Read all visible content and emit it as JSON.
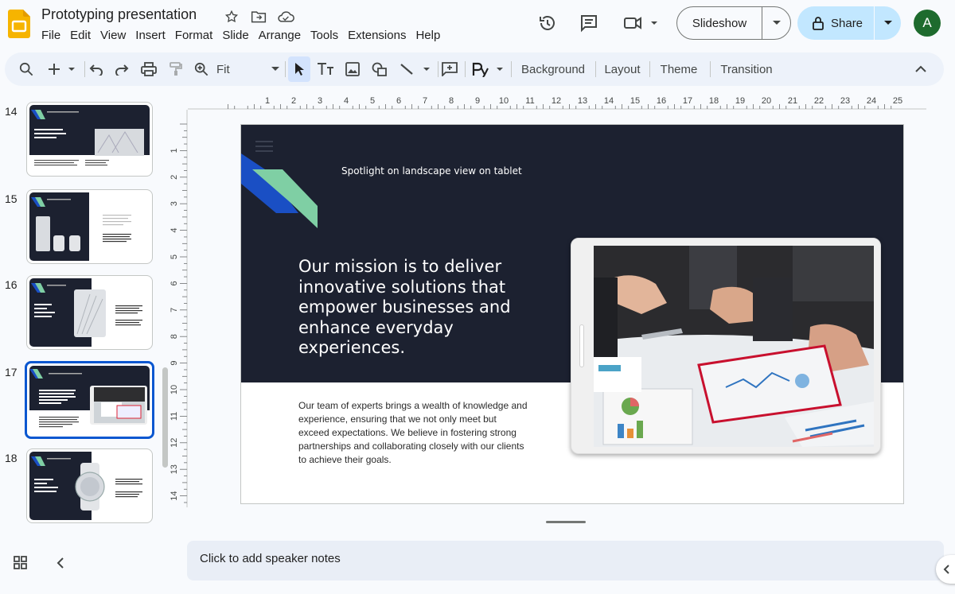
{
  "app": {
    "doc_title": "Prototyping presentation",
    "menu": [
      "File",
      "Edit",
      "View",
      "Insert",
      "Format",
      "Slide",
      "Arrange",
      "Tools",
      "Extensions",
      "Help"
    ],
    "slideshow_label": "Slideshow",
    "share_label": "Share",
    "avatar_initial": "A"
  },
  "toolbar": {
    "zoom_value": "Fit",
    "background_label": "Background",
    "layout_label": "Layout",
    "theme_label": "Theme",
    "transition_label": "Transition"
  },
  "filmstrip": {
    "slides": [
      {
        "num": "14",
        "layout": "text-image-top",
        "text": "Lorem ipsum dolor sit consectetur amet adipiscing donec"
      },
      {
        "num": "15",
        "layout": "image-text",
        "text": "Lorem ipsum dolor sit consectetur amet adipiscing donec"
      },
      {
        "num": "16",
        "layout": "text-image-split",
        "text": "Lorem ipsum dolor sit consectetur amet adipiscing donec"
      },
      {
        "num": "17",
        "layout": "current",
        "text": "Our mission is to deliver innovative solutions that empower businesses and enhance everyday experiences."
      },
      {
        "num": "18",
        "layout": "text-watch",
        "text": "Lorem ipsum dolor sit consectetur amet adipiscing donec"
      }
    ],
    "selected": "17"
  },
  "ruler": {
    "top_ticks": [
      "1",
      "2",
      "3",
      "4",
      "5",
      "6",
      "7",
      "8",
      "9",
      "10",
      "11",
      "12",
      "13",
      "14",
      "15",
      "16",
      "17",
      "18",
      "19",
      "20",
      "21",
      "22",
      "23",
      "24",
      "25"
    ],
    "left_ticks": [
      "1",
      "2",
      "3",
      "4",
      "5",
      "6",
      "7",
      "8",
      "9",
      "10",
      "11",
      "12",
      "13",
      "14"
    ]
  },
  "slide": {
    "subtitle": "Spotlight on landscape view on tablet",
    "heading": "Our mission is to deliver innovative solutions that empower businesses and enhance everyday experiences.",
    "body": "Our team of experts brings a wealth of knowledge and experience, ensuring that we not only meet but exceed expectations. We believe in fostering strong partnerships and collaborating closely with our clients to achieve their goals.",
    "accent_blue": "#1a4fc4",
    "accent_green": "#7fcfa4",
    "dark_bg": "#1c2130"
  },
  "notes": {
    "placeholder": "Click to add speaker notes"
  },
  "colors": {
    "primary": "#0b57d0",
    "share_bg": "#c2e7ff",
    "avatar_bg": "#1e6b2e"
  }
}
